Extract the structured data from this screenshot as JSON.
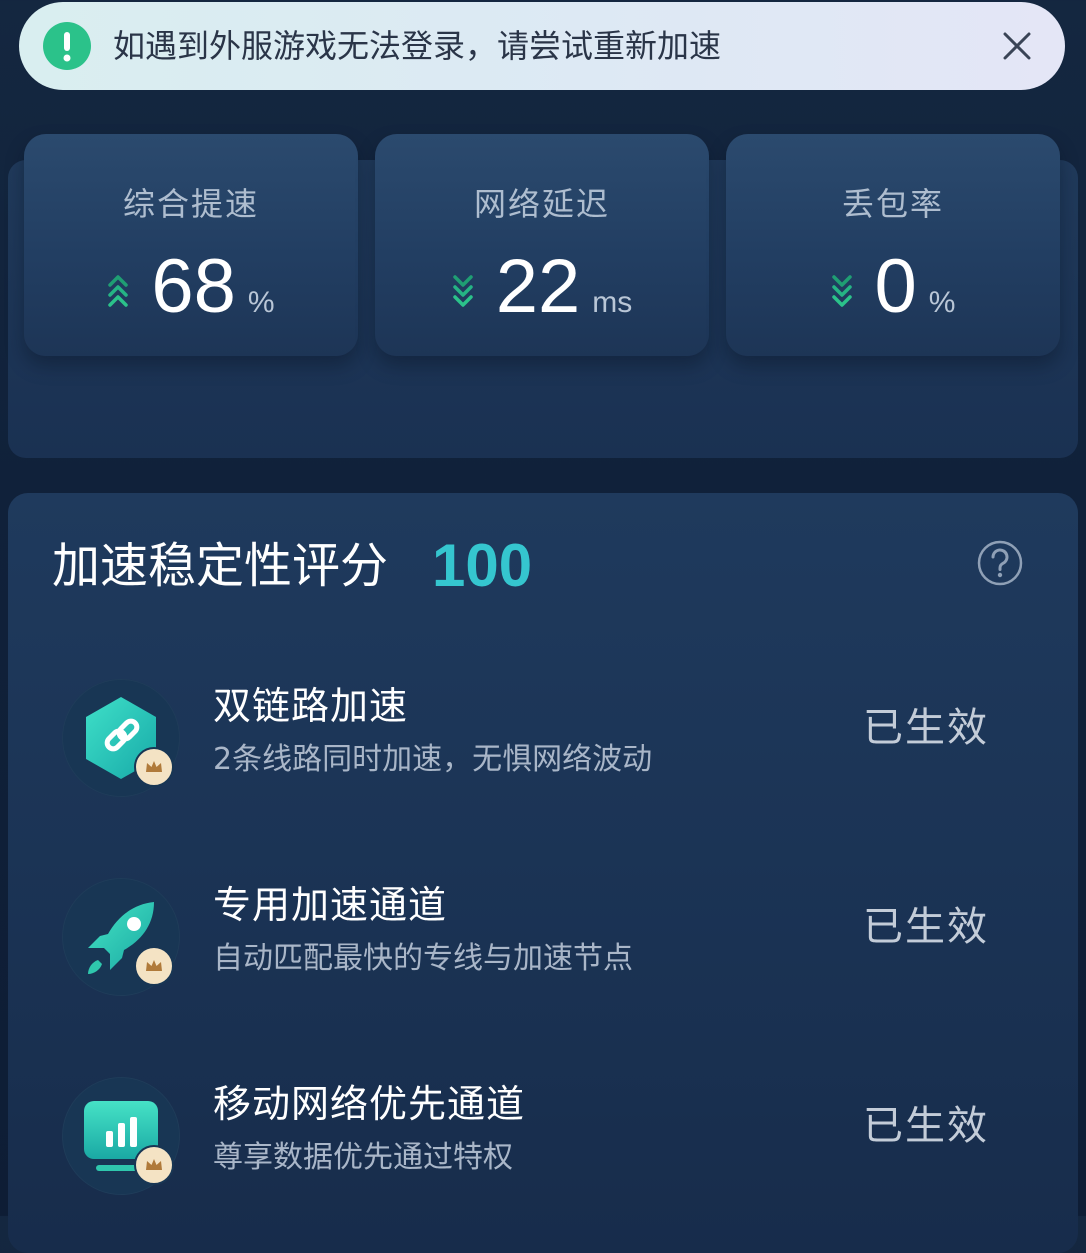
{
  "notice": {
    "text": "如遇到外服游戏无法登录，请尝试重新加速",
    "info_icon": "exclamation-icon",
    "close_icon": "close-icon"
  },
  "stats": [
    {
      "label": "综合提速",
      "value": "68",
      "unit": "%",
      "trend": "up"
    },
    {
      "label": "网络延迟",
      "value": "22",
      "unit": "ms",
      "trend": "down"
    },
    {
      "label": "丢包率",
      "value": "0",
      "unit": "%",
      "trend": "down"
    }
  ],
  "stability": {
    "title": "加速稳定性评分",
    "score": "100",
    "help_icon": "question-circle-icon",
    "features": [
      {
        "title": "双链路加速",
        "desc": "2条线路同时加速，无惧网络波动",
        "status": "已生效",
        "icon": "link-icon"
      },
      {
        "title": "专用加速通道",
        "desc": "自动匹配最快的专线与加速节点",
        "status": "已生效",
        "icon": "rocket-icon"
      },
      {
        "title": "移动网络优先通道",
        "desc": "尊享数据优先通过特权",
        "status": "已生效",
        "icon": "bar-chart-icon"
      }
    ]
  },
  "colors": {
    "accent_teal": "#35c6cf",
    "trend_green": "#2bc28a",
    "background": "#10213a",
    "crown_badge": "#f4e3c4"
  }
}
